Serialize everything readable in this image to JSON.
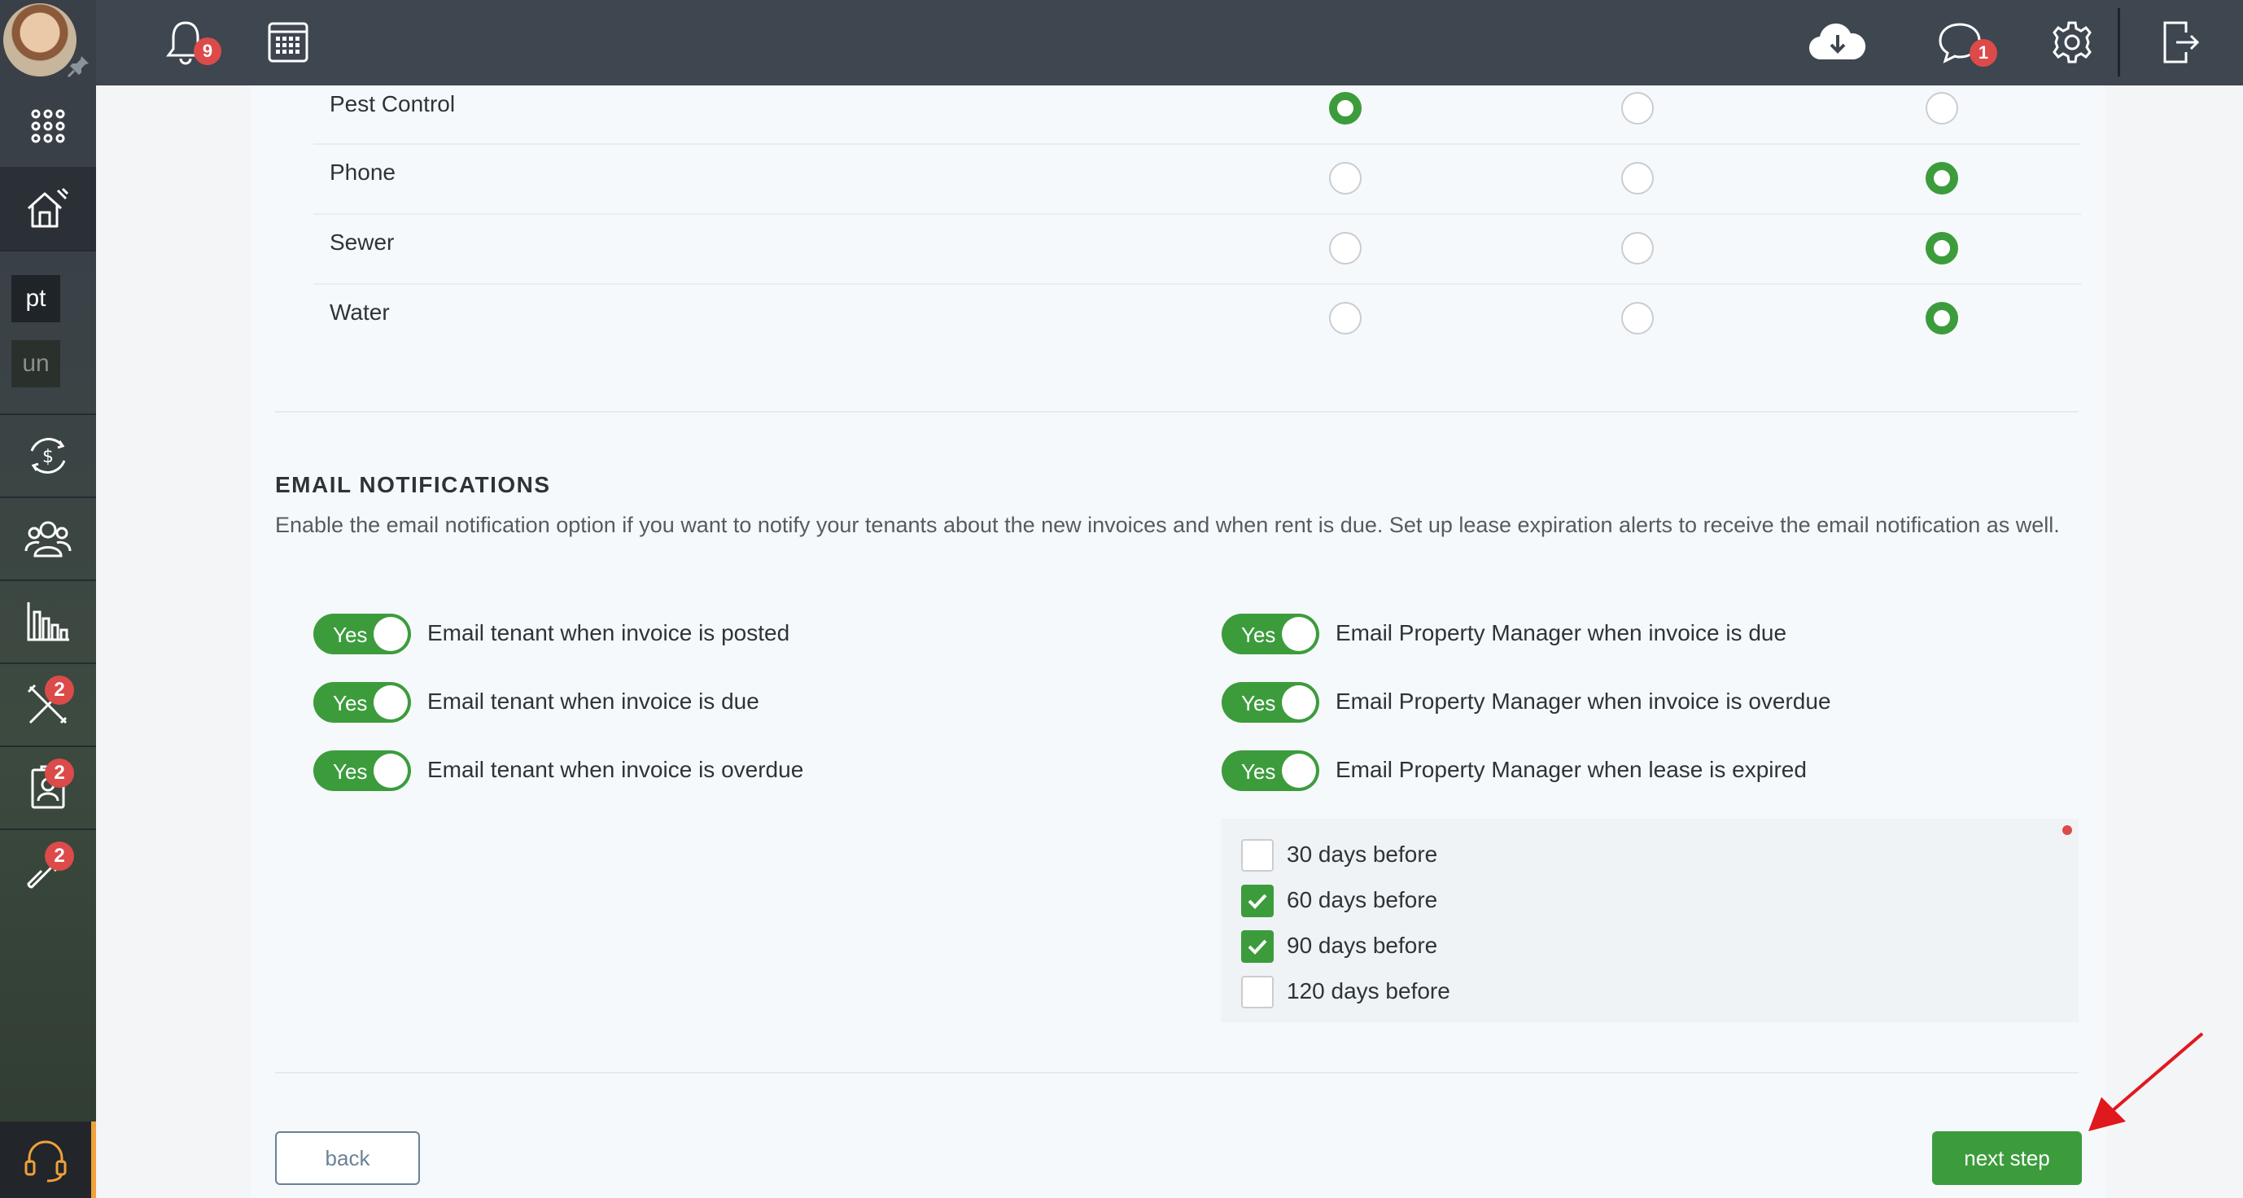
{
  "topbar": {
    "notifications_count": "9",
    "messages_count": "1",
    "icons": [
      "bell-icon",
      "calendar-icon",
      "cloud-download-icon",
      "chat-icon",
      "gear-icon",
      "logout-icon"
    ]
  },
  "sidebar": {
    "tags": [
      "pt",
      "un"
    ],
    "badges": {
      "maintenance": "2",
      "tenants": "2",
      "integrations": "2"
    },
    "icons": [
      "apps-grid-icon",
      "property-icon",
      "finance-icon",
      "people-icon",
      "reports-icon",
      "maintenance-icon",
      "tenant-screening-icon",
      "integrations-icon",
      "support-icon"
    ]
  },
  "utilities": [
    {
      "name": "Pest Control",
      "selected": 1
    },
    {
      "name": "Phone",
      "selected": 3
    },
    {
      "name": "Sewer",
      "selected": 3
    },
    {
      "name": "Water",
      "selected": 3
    }
  ],
  "email_section": {
    "title": "EMAIL NOTIFICATIONS",
    "description": "Enable the email notification option if you want to notify your tenants about the new invoices and when rent is due. Set up lease expiration alerts to receive the email notification as well.",
    "toggle_label": "Yes",
    "left_toggles": [
      "Email tenant when invoice is posted",
      "Email tenant when invoice is due",
      "Email tenant when invoice is overdue"
    ],
    "right_toggles": [
      "Email Property Manager when invoice is due",
      "Email Property Manager when invoice is overdue",
      "Email Property Manager when lease is expired"
    ],
    "lease_alerts": [
      {
        "label": "30 days before",
        "checked": false
      },
      {
        "label": "60 days before",
        "checked": true
      },
      {
        "label": "90 days before",
        "checked": true
      },
      {
        "label": "120 days before",
        "checked": false
      }
    ]
  },
  "buttons": {
    "back": "back",
    "next": "next step"
  },
  "colors": {
    "accent": "#3c9c3c",
    "badge": "#dc4a4a",
    "topbar": "#3e4650",
    "annotation_arrow": "#e0191f"
  }
}
